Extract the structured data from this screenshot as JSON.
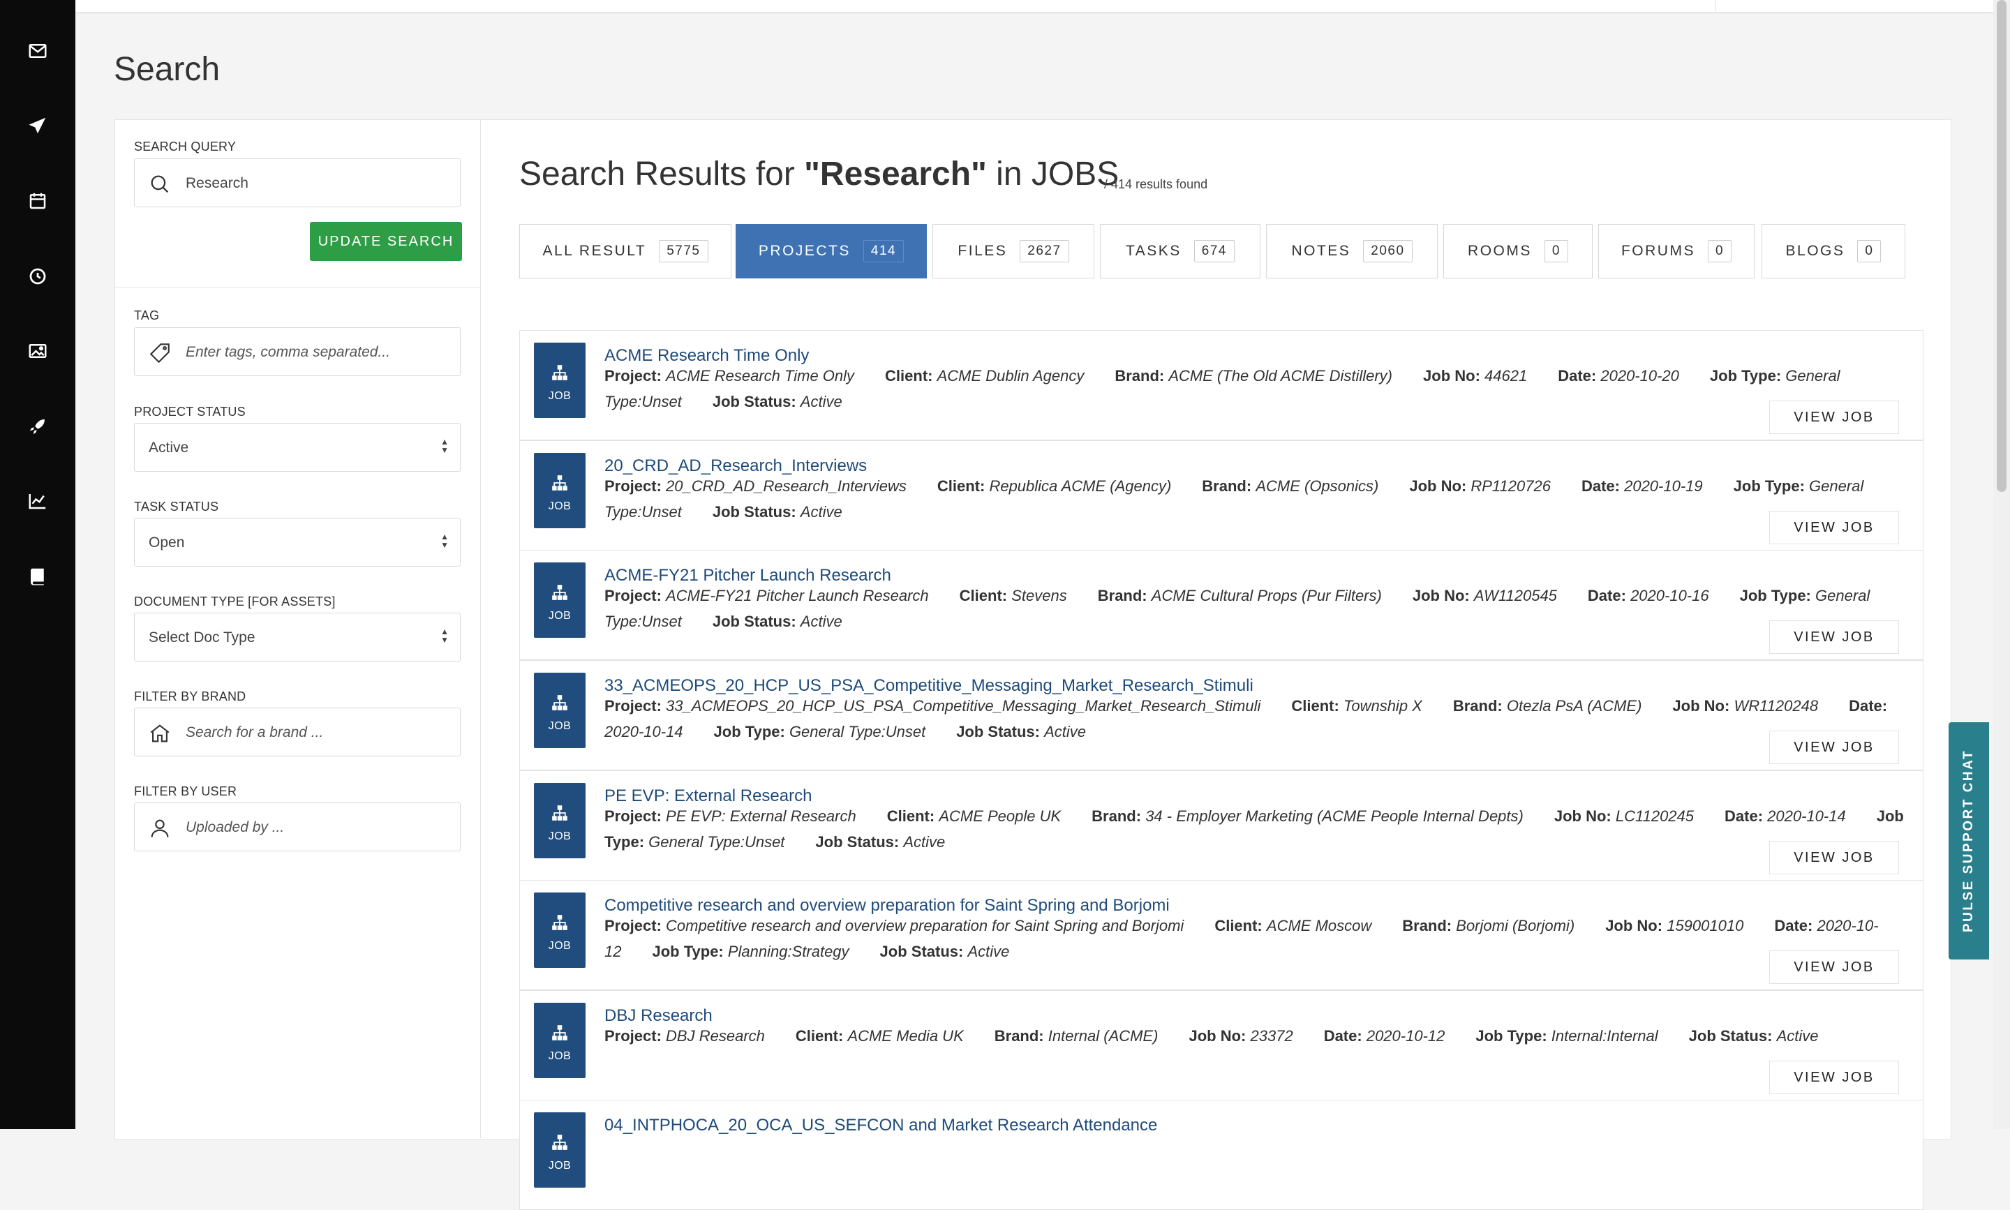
{
  "nav": {
    "icons": [
      "mail-icon",
      "send-icon",
      "calendar-icon",
      "clock-icon",
      "image-icon",
      "rocket-icon",
      "chart-icon",
      "book-icon"
    ]
  },
  "page": {
    "title": "Search"
  },
  "filters": {
    "search_query_label": "SEARCH QUERY",
    "search_query_value": "Research",
    "update_button": "UPDATE SEARCH",
    "tag_label": "TAG",
    "tag_placeholder": "Enter tags, comma separated...",
    "project_status_label": "PROJECT STATUS",
    "project_status_value": "Active",
    "task_status_label": "TASK STATUS",
    "task_status_value": "Open",
    "doc_type_label": "DOCUMENT TYPE [FOR ASSETS]",
    "doc_type_value": "Select Doc Type",
    "brand_label": "FILTER BY BRAND",
    "brand_placeholder": "Search for a brand ...",
    "user_label": "FILTER BY USER",
    "user_placeholder": "Uploaded by ..."
  },
  "results": {
    "title_prefix": "Search Results for ",
    "query": "\"Research\"",
    "title_suffix": " in JOBS",
    "count_text": "/ 414 results found"
  },
  "tabs": [
    {
      "label": "ALL RESULT",
      "count": "5775"
    },
    {
      "label": "PROJECTS",
      "count": "414"
    },
    {
      "label": "FILES",
      "count": "2627"
    },
    {
      "label": "TASKS",
      "count": "674"
    },
    {
      "label": "NOTES",
      "count": "2060"
    },
    {
      "label": "ROOMS",
      "count": "0"
    },
    {
      "label": "FORUMS",
      "count": "0"
    },
    {
      "label": "BLOGS",
      "count": "0"
    }
  ],
  "labels": {
    "badge": "JOB",
    "view_job": "VIEW JOB",
    "project": "Project:",
    "client": "Client:",
    "brand": "Brand:",
    "job_no": "Job No:",
    "date": "Date:",
    "job_type": "Job Type:",
    "job_status": "Job Status:"
  },
  "jobs": [
    {
      "title": "ACME Research Time Only",
      "line1": [
        [
          "Project:",
          "ACME Research Time Only"
        ],
        [
          "Client:",
          "ACME Dublin Agency"
        ],
        [
          "Brand:",
          "ACME (The Old ACME Distillery)"
        ],
        [
          "Job No:",
          "44621"
        ],
        [
          "Date:",
          "2020-10-20"
        ],
        [
          "Job Type:",
          "General"
        ]
      ],
      "line2": [
        [
          "",
          "Type:Unset"
        ],
        [
          "Job Status:",
          "Active"
        ]
      ]
    },
    {
      "title": "20_CRD_AD_Research_Interviews",
      "line1": [
        [
          "Project:",
          "20_CRD_AD_Research_Interviews"
        ],
        [
          "Client:",
          "Republica ACME (Agency)"
        ],
        [
          "Brand:",
          "ACME (Opsonics)"
        ],
        [
          "Job No:",
          "RP1120726"
        ],
        [
          "Date:",
          "2020-10-19"
        ],
        [
          "Job Type:",
          "General"
        ]
      ],
      "line2": [
        [
          "",
          "Type:Unset"
        ],
        [
          "Job Status:",
          "Active"
        ]
      ]
    },
    {
      "title": "ACME-FY21 Pitcher Launch Research",
      "line1": [
        [
          "Project:",
          "ACME-FY21 Pitcher Launch Research"
        ],
        [
          "Client:",
          "Stevens"
        ],
        [
          "Brand:",
          "ACME Cultural Props (Pur Filters)"
        ],
        [
          "Job No:",
          "AW1120545"
        ],
        [
          "Date:",
          "2020-10-16"
        ],
        [
          "Job Type:",
          "General"
        ]
      ],
      "line2": [
        [
          "",
          "Type:Unset"
        ],
        [
          "Job Status:",
          "Active"
        ]
      ]
    },
    {
      "title": "33_ACMEOPS_20_HCP_US_PSA_Competitive_Messaging_Market_Research_Stimuli",
      "line1": [
        [
          "Project:",
          "33_ACMEOPS_20_HCP_US_PSA_Competitive_Messaging_Market_Research_Stimuli"
        ],
        [
          "Client:",
          "Township X"
        ],
        [
          "Brand:",
          "Otezla PsA (ACME)"
        ],
        [
          "Job No:",
          "WR1120248"
        ],
        [
          "Date:",
          ""
        ]
      ],
      "line2": [
        [
          "",
          "2020-10-14"
        ],
        [
          "Job Type:",
          "General Type:Unset"
        ],
        [
          "Job Status:",
          "Active"
        ]
      ]
    },
    {
      "title": "PE EVP: External Research",
      "line1": [
        [
          "Project:",
          "PE EVP: External Research"
        ],
        [
          "Client:",
          "ACME People UK"
        ],
        [
          "Brand:",
          "34 - Employer Marketing (ACME People Internal Depts)"
        ],
        [
          "Job No:",
          "LC1120245"
        ],
        [
          "Date:",
          "2020-10-14"
        ],
        [
          "Job",
          ""
        ]
      ],
      "line2": [
        [
          "Type:",
          "General Type:Unset"
        ],
        [
          "Job Status:",
          "Active"
        ]
      ]
    },
    {
      "title": "Competitive research and overview preparation for Saint Spring and Borjomi",
      "line1": [
        [
          "Project:",
          "Competitive research and overview preparation for Saint Spring and Borjomi"
        ],
        [
          "Client:",
          "ACME Moscow"
        ],
        [
          "Brand:",
          "Borjomi (Borjomi)"
        ],
        [
          "Job No:",
          "159001010"
        ],
        [
          "Date:",
          "2020-10-"
        ]
      ],
      "line2": [
        [
          "",
          "12"
        ],
        [
          "Job Type:",
          "Planning:Strategy"
        ],
        [
          "Job Status:",
          "Active"
        ]
      ]
    },
    {
      "title": "DBJ Research",
      "line1": [
        [
          "Project:",
          "DBJ Research"
        ],
        [
          "Client:",
          "ACME Media UK"
        ],
        [
          "Brand:",
          "Internal (ACME)"
        ],
        [
          "Job No:",
          "23372"
        ],
        [
          "Date:",
          "2020-10-12"
        ],
        [
          "Job Type:",
          "Internal:Internal"
        ],
        [
          "Job Status:",
          "Active"
        ]
      ],
      "line2": []
    },
    {
      "title": "04_INTPHOCA_20_OCA_US_SEFCON and Market Research Attendance",
      "line1": [],
      "line2": []
    }
  ],
  "pulse_chat": {
    "label": "PULSE SUPPORT CHAT"
  }
}
